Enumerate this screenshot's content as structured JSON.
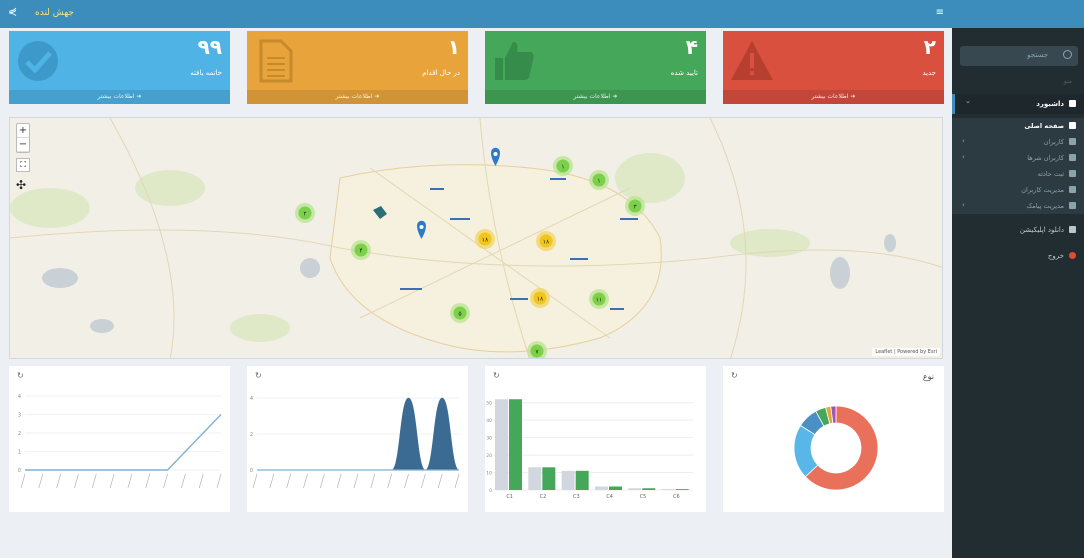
{
  "header": {
    "brand": "جهش لنده"
  },
  "sidebar": {
    "search_placeholder": "جستجو",
    "header": "منو",
    "items": [
      {
        "label": "داشبورد",
        "kind": "main"
      },
      {
        "label": "صفحه اصلی",
        "kind": "sub-active"
      },
      {
        "label": "کاربران",
        "kind": "sub"
      },
      {
        "label": "کاربران شرها",
        "kind": "sub"
      },
      {
        "label": "ثبت حادثه",
        "kind": "sub"
      },
      {
        "label": "مدیریت کاربران",
        "kind": "sub"
      },
      {
        "label": "مدیریت پیامک",
        "kind": "sub"
      },
      {
        "label": "دانلود اپلیکیشن",
        "kind": "main2"
      },
      {
        "label": "خروج",
        "kind": "red"
      }
    ]
  },
  "info_boxes": [
    {
      "number": "۹۹",
      "title": "خاتمه یافته",
      "footer": "اطلاعات بیشتر",
      "color": "#4fb3e6",
      "icon": "check-circle-icon"
    },
    {
      "number": "۱",
      "title": "در حال اقدام",
      "footer": "اطلاعات بیشتر",
      "color": "#e8a43b",
      "icon": "document-icon"
    },
    {
      "number": "۴",
      "title": "تایید شده",
      "footer": "اطلاعات بیشتر",
      "color": "#44a75a",
      "icon": "thumbs-up-icon"
    },
    {
      "number": "۲",
      "title": "جدید",
      "footer": "اطلاعات بیشتر",
      "color": "#d9503f",
      "icon": "warning-icon"
    }
  ],
  "map": {
    "attribution": "Leaflet | Powered by Esri",
    "clusters": [
      {
        "label": "۱",
        "color": "green"
      },
      {
        "label": "۱",
        "color": "green"
      },
      {
        "label": "۲",
        "color": "green"
      },
      {
        "label": "۳",
        "color": "green"
      },
      {
        "label": "۴",
        "color": "green"
      },
      {
        "label": "۱۸",
        "color": "yellow"
      },
      {
        "label": "۱۸",
        "color": "yellow"
      },
      {
        "label": "۱۸",
        "color": "yellow"
      },
      {
        "label": "۱۱",
        "color": "green"
      },
      {
        "label": "۵",
        "color": "green"
      },
      {
        "label": "۷",
        "color": "green"
      }
    ]
  },
  "panels": [
    {
      "title": "",
      "refresh": "↻"
    },
    {
      "title": "",
      "refresh": "↻"
    },
    {
      "title": "",
      "refresh": "↻"
    },
    {
      "title": "نوع",
      "refresh": "↻"
    }
  ],
  "chart_data": [
    {
      "type": "line",
      "y_ticks": [
        "0",
        "1",
        "2",
        "3",
        "4"
      ],
      "ylim": [
        0,
        4
      ],
      "series": [
        {
          "values": [
            0,
            0,
            0,
            0,
            0,
            0,
            0,
            0,
            0,
            1,
            2,
            3
          ]
        }
      ],
      "color": "#7fb1d3"
    },
    {
      "type": "area",
      "y_ticks": [
        "0",
        "2",
        "4"
      ],
      "ylim": [
        0,
        4
      ],
      "series": [
        {
          "values": [
            0,
            0,
            0,
            0,
            0,
            0,
            0,
            0,
            0,
            4,
            0,
            4,
            0
          ]
        }
      ],
      "color": "#3b6b92"
    },
    {
      "type": "bar",
      "categories": [
        "C1",
        "C2",
        "C3",
        "C4",
        "C5",
        "C6"
      ],
      "y_ticks": [
        "0",
        "10",
        "20",
        "30",
        "40",
        "50"
      ],
      "ylim": [
        0,
        55
      ],
      "series": [
        {
          "values": [
            52,
            13,
            11,
            2,
            1,
            0.5
          ],
          "color": "#d2d6de"
        },
        {
          "values": [
            52,
            13,
            11,
            2,
            1,
            0.5
          ],
          "color": "#44a75a"
        }
      ]
    },
    {
      "type": "pie",
      "series": [
        {
          "values": [
            63,
            21,
            8,
            4,
            2,
            2
          ]
        }
      ],
      "colors": [
        "#e9705b",
        "#58b6e8",
        "#4a90c2",
        "#44a75a",
        "#e8a43b",
        "#9b59b6"
      ]
    }
  ]
}
